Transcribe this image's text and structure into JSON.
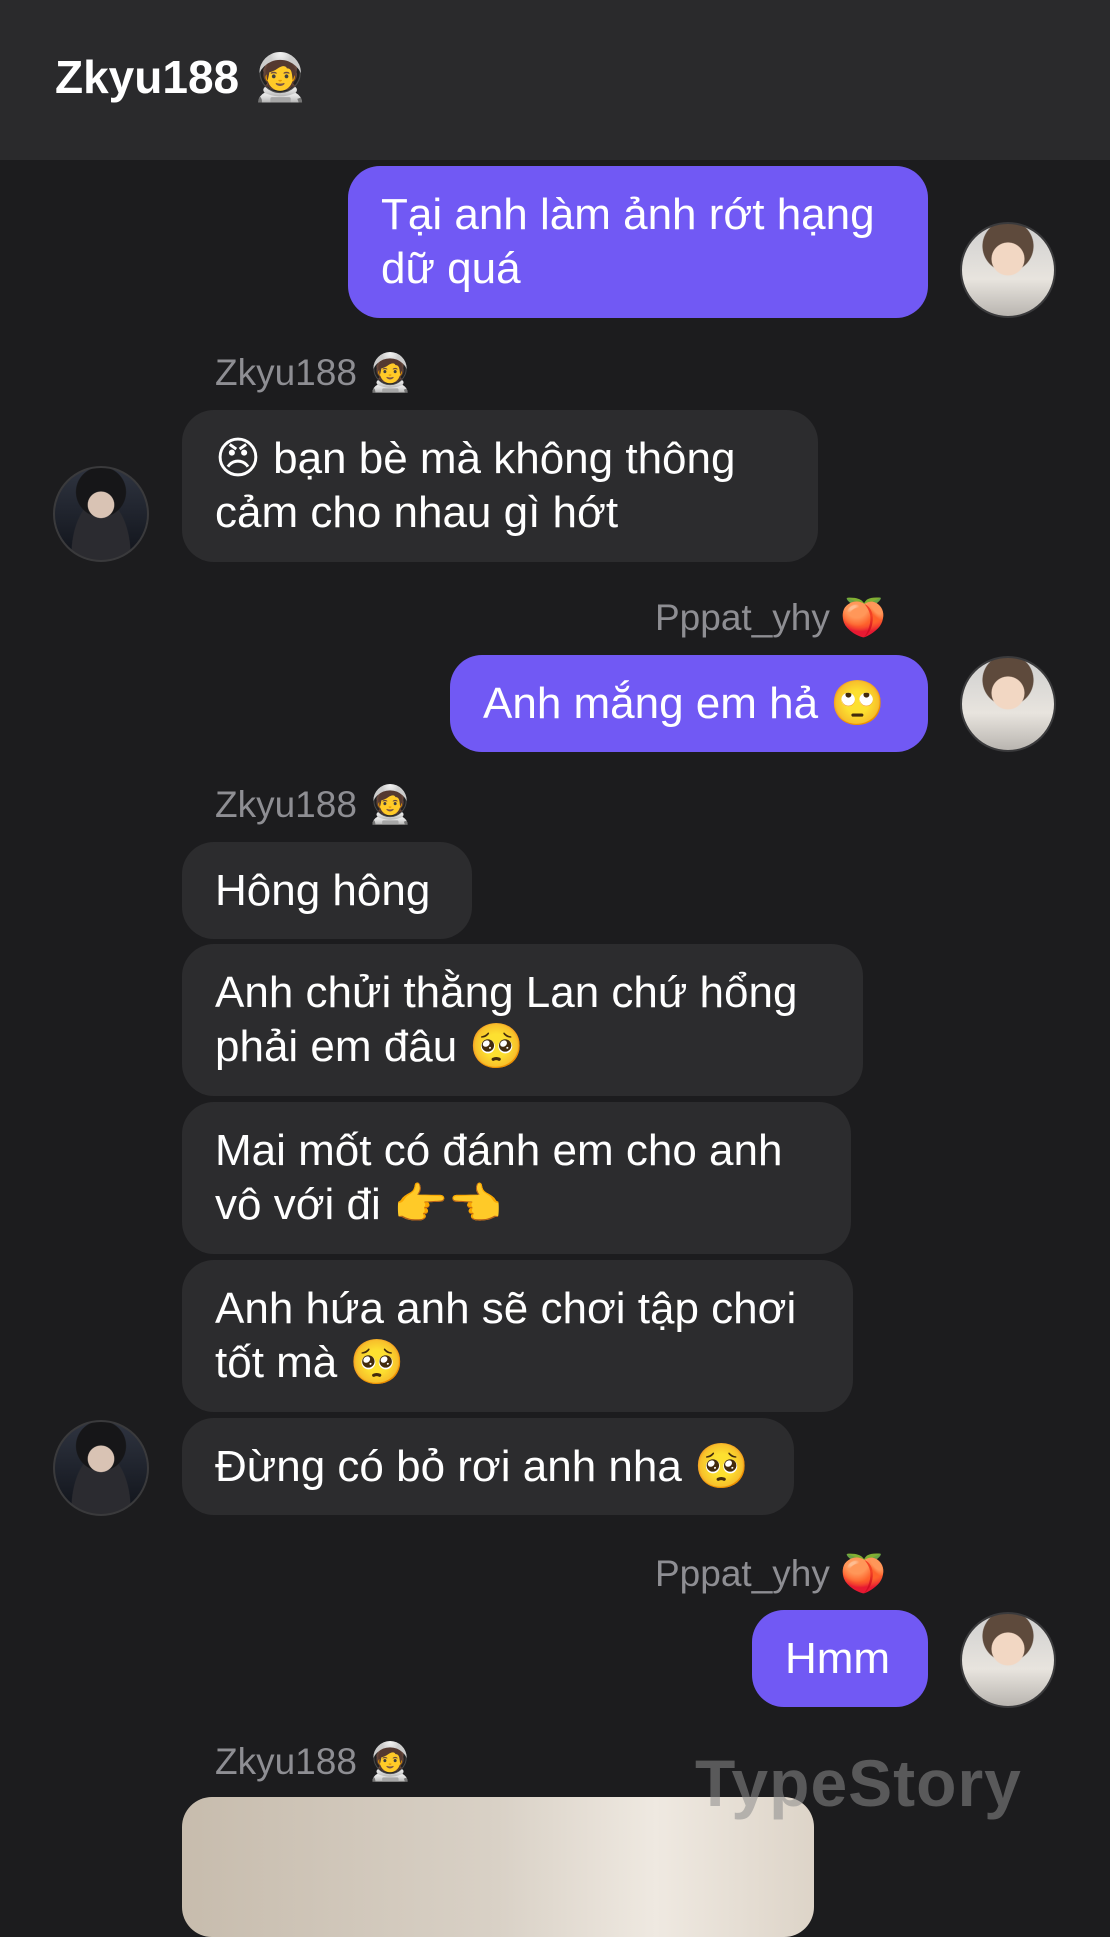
{
  "header": {
    "title": "Zkyu188 🧑‍🚀"
  },
  "messages": [
    {
      "text": "Tại anh làm ảnh rớt hạng dữ quá"
    },
    {
      "sender": "Zkyu188 🧑‍🚀",
      "text": "😠 bạn bè mà không thông cảm cho nhau gì hớt"
    },
    {
      "sender": "Pppat_yhy 🍑",
      "text": "Anh mắng em hả 🙄"
    },
    {
      "sender": "Zkyu188 🧑‍🚀"
    },
    {
      "text": "Hông hông"
    },
    {
      "text": "Anh chửi thằng Lan chứ hổng phải em đâu 🥺"
    },
    {
      "text": "Mai mốt có đánh em cho anh vô với đi 👉👈"
    },
    {
      "text": "Anh hứa anh sẽ chơi tập chơi tốt mà 🥺"
    },
    {
      "text": "Đừng có bỏ rơi anh nha 🥺"
    },
    {
      "sender": "Pppat_yhy 🍑",
      "text": "Hmm"
    },
    {
      "sender": "Zkyu188 🧑‍🚀"
    }
  ],
  "watermark": "TypeStory",
  "colors": {
    "outgoing": "#7159f4",
    "incoming": "#2c2c2e",
    "background": "#1c1c1e"
  }
}
